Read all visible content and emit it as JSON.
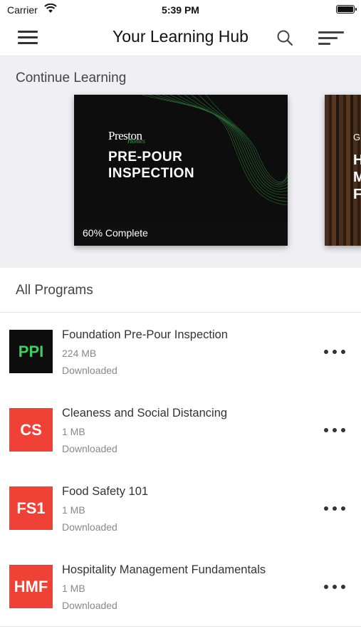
{
  "status_bar": {
    "carrier": "Carrier",
    "time": "5:39 PM"
  },
  "nav": {
    "title": "Your Learning Hub",
    "icons": [
      "hamburger-menu-icon",
      "search-icon",
      "sort-lines-icon"
    ]
  },
  "continue_learning": {
    "title": "Continue Learning",
    "cards": [
      {
        "brand": "Preston",
        "brand_sub": "Homes",
        "title": "PRE-POUR INSPECTION",
        "progress_label": "60% Complete",
        "progress": 0.6
      },
      {
        "letter": "G",
        "letters": "H M F"
      }
    ]
  },
  "all_programs": {
    "title": "All Programs",
    "items": [
      {
        "abbr": "PPI",
        "name": "Foundation Pre-Pour Inspection",
        "size": "224 MB",
        "status": "Downloaded",
        "thumb_bg": "#0d0d0d",
        "thumb_fg": "#3bd15a"
      },
      {
        "abbr": "CS",
        "name": "Cleaness and Social Distancing",
        "size": "1 MB",
        "status": "Downloaded",
        "thumb_bg": "#ef4135",
        "thumb_fg": "#ffffff"
      },
      {
        "abbr": "FS1",
        "name": "Food Safety 101",
        "size": "1 MB",
        "status": "Downloaded",
        "thumb_bg": "#ef4135",
        "thumb_fg": "#ffffff"
      },
      {
        "abbr": "HMF",
        "name": "Hospitality Management Fundamentals",
        "size": "1 MB",
        "status": "Downloaded",
        "thumb_bg": "#ef4135",
        "thumb_fg": "#ffffff"
      }
    ]
  }
}
